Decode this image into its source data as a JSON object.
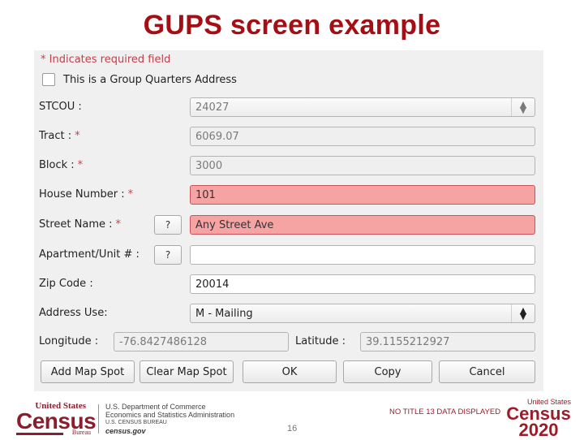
{
  "slide": {
    "title": "GUPS screen example",
    "page_number": "16",
    "disclaimer": "NO TITLE 13 DATA DISPLAYED"
  },
  "form": {
    "required_note": "* Indicates required field",
    "group_quarters": {
      "label": "This is a Group Quarters Address",
      "checked": false
    },
    "fields": {
      "stcou": {
        "label": "STCOU :",
        "value": "24027",
        "required": false
      },
      "tract": {
        "label": "Tract :",
        "value": "6069.07",
        "required": true
      },
      "block": {
        "label": "Block :",
        "value": "3000",
        "required": true
      },
      "house_number": {
        "label": "House Number :",
        "value": "101",
        "required": true
      },
      "street_name": {
        "label": "Street Name :",
        "value": "Any Street Ave",
        "required": true,
        "help_button": "?"
      },
      "apartment": {
        "label": "Apartment/Unit # :",
        "value": "",
        "required": false,
        "help_button": "?"
      },
      "zip_code": {
        "label": "Zip Code :",
        "value": "20014",
        "required": false
      },
      "address_use": {
        "label": "Address Use:",
        "value": "M - Mailing"
      },
      "longitude": {
        "label": "Longitude :",
        "value": "-76.8427486128"
      },
      "latitude": {
        "label": "Latitude :",
        "value": "39.1155212927"
      }
    },
    "required_marker": "*",
    "buttons": {
      "add_map_spot": "Add Map Spot",
      "clear_map_spot": "Clear Map Spot",
      "ok": "OK",
      "copy": "Copy",
      "cancel": "Cancel"
    }
  },
  "footer": {
    "census_logo": {
      "top": "United States",
      "main": "Census",
      "bottom": "Bureau"
    },
    "department": {
      "line1": "U.S. Department of Commerce",
      "line2": "Economics and Statistics Administration",
      "line3": "U.S. CENSUS BUREAU",
      "line4": "census.gov"
    },
    "census2020_logo": {
      "top": "United States",
      "main": "Census",
      "year": "2020"
    }
  },
  "colors": {
    "title": "#a50e14",
    "error_field": "#f6a3a3",
    "required_star": "#d04050",
    "census_brand": "#8a1e2e"
  }
}
